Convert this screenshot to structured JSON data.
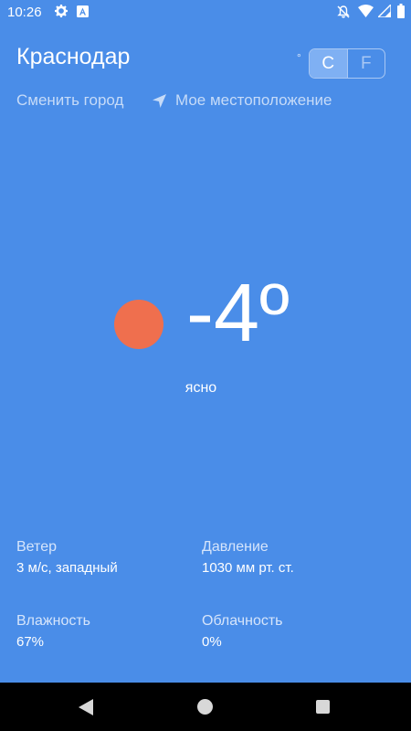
{
  "status_bar": {
    "time": "10:26",
    "icons": [
      "gear-icon",
      "a-icon",
      "bell-off-icon",
      "wifi-icon",
      "signal-icon",
      "battery-icon"
    ]
  },
  "header": {
    "city": "Краснодар",
    "unit_degree_symbol": "°",
    "unit_celsius": "C",
    "unit_fahrenheit": "F",
    "selected_unit": "C",
    "change_city_label": "Сменить город",
    "location_label": "Мое местоположение"
  },
  "weather": {
    "temperature": "-4º",
    "condition": "ясно",
    "icon": "sun-dot-icon",
    "icon_color": "#ef6f4e"
  },
  "details": {
    "wind_label": "Ветер",
    "wind_value": "3 м/с, западный",
    "pressure_label": "Давление",
    "pressure_value": "1030 мм рт. ст.",
    "humidity_label": "Влажность",
    "humidity_value": "67%",
    "cloudiness_label": "Облачность",
    "cloudiness_value": "0%"
  },
  "nav_bar": {
    "icons": [
      "back-icon",
      "home-icon",
      "recents-icon"
    ]
  },
  "colors": {
    "background": "#4a8de8",
    "accent_dim": "#a9c8f4",
    "nav_bar": "#000000"
  }
}
